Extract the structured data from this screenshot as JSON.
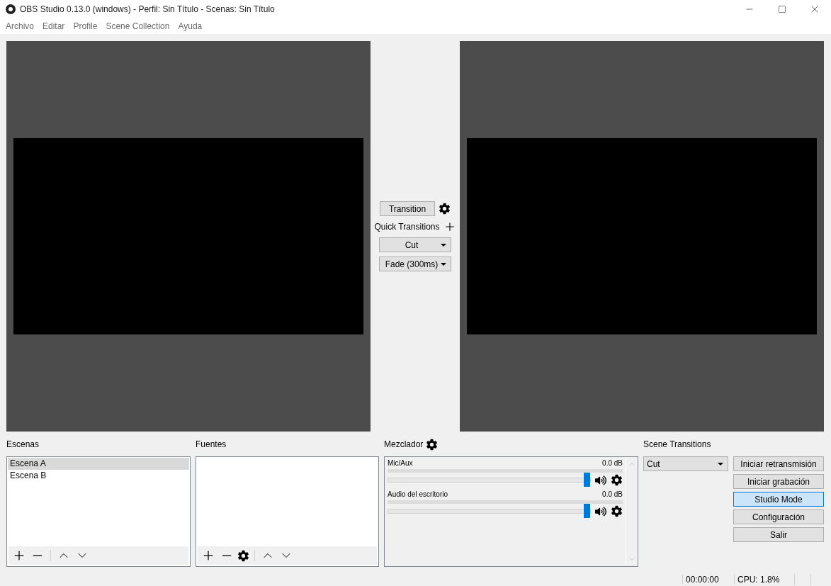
{
  "window": {
    "title": "OBS Studio 0.13.0 (windows) - Perfil: Sin Título - Scenas: Sin Título"
  },
  "menu": [
    "Archivo",
    "Editar",
    "Profile",
    "Scene Collection",
    "Ayuda"
  ],
  "transition_panel": {
    "button": "Transition",
    "quick_label": "Quick Transitions",
    "quick_transitions": [
      "Cut",
      "Fade (300ms)"
    ]
  },
  "scenes": {
    "title": "Escenas",
    "items": [
      {
        "label": "Escena A",
        "selected": true
      },
      {
        "label": "Escena B",
        "selected": false
      }
    ]
  },
  "sources": {
    "title": "Fuentes"
  },
  "mixer": {
    "title": "Mezclador",
    "channels": [
      {
        "name": "Mic/Aux",
        "reading": "0.0 dB",
        "level": 1
      },
      {
        "name": "Audio del escritorio",
        "reading": "0.0 dB",
        "level": 1
      }
    ]
  },
  "scene_transitions": {
    "title": "Scene Transitions",
    "value": "Cut"
  },
  "controls": [
    {
      "label": "Iniciar retransmisión",
      "selected": false
    },
    {
      "label": "Iniciar grabación",
      "selected": false
    },
    {
      "label": "Studio Mode",
      "selected": true
    },
    {
      "label": "Configuración",
      "selected": false
    },
    {
      "label": "Salir",
      "selected": false
    }
  ],
  "status_bar": {
    "time": "00:00:00",
    "cpu": "CPU: 1.8%"
  }
}
